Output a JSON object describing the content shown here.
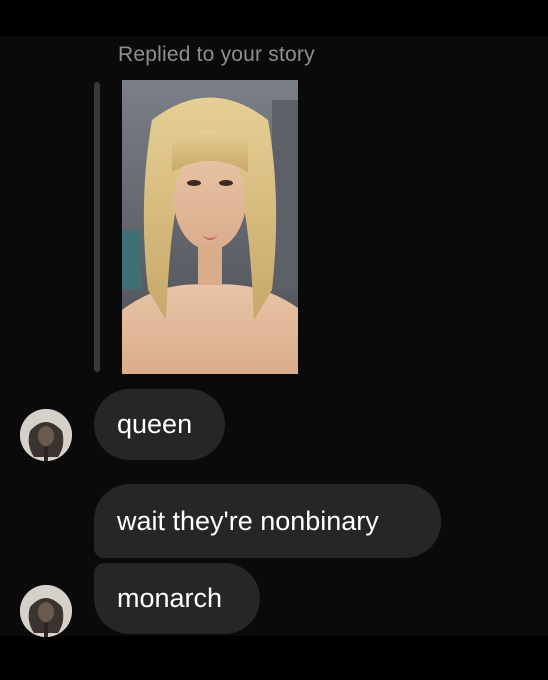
{
  "thread": {
    "replied_caption": "Replied to your story",
    "story_thumbnail": {
      "icon": "story-photo-portrait"
    },
    "messages": [
      {
        "text": "queen",
        "sender": "other"
      },
      {
        "text": "wait they're nonbinary",
        "sender": "other"
      },
      {
        "text": "monarch",
        "sender": "other"
      }
    ]
  },
  "colors": {
    "background": "#0a0a0a",
    "bubble": "#262626",
    "caption": "#8e8e8e",
    "message_text": "#ffffff",
    "reply_bar": "#3a3a3a"
  }
}
